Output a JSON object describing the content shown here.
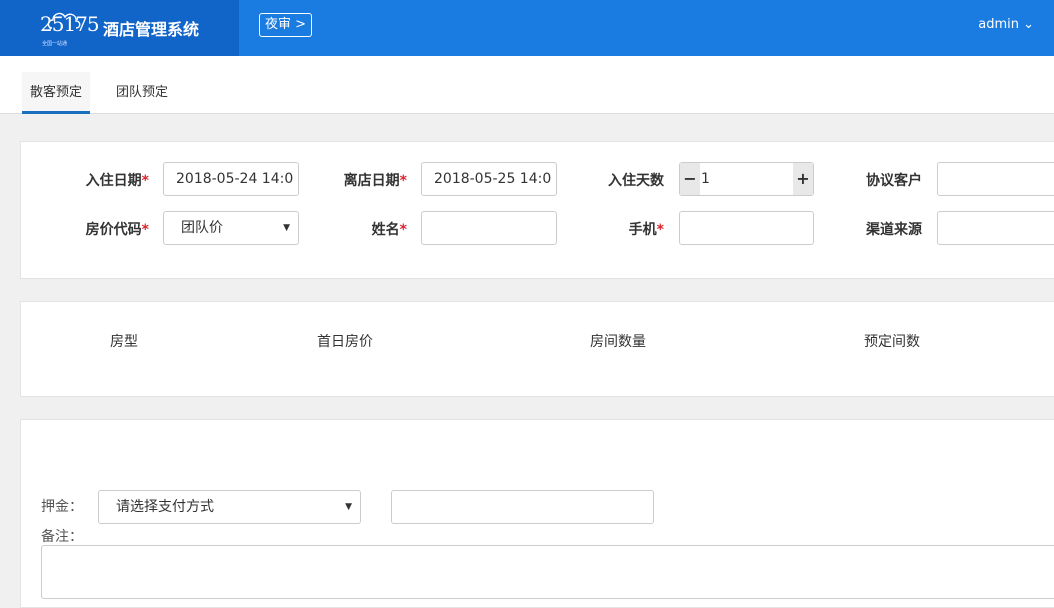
{
  "header": {
    "logo_number": "25175",
    "logo_tagline": "全国一站通",
    "app_name": "酒店管理系统",
    "night_audit_label": "夜审 >",
    "user_label": "admin ⌄"
  },
  "tabs": [
    {
      "label": "散客预定",
      "active": true
    },
    {
      "label": "团队预定",
      "active": false
    }
  ],
  "form": {
    "checkin_date_label": "入住日期",
    "checkin_date_value": "2018-05-24 14:0",
    "checkout_date_label": "离店日期",
    "checkout_date_value": "2018-05-25 14:0",
    "stay_days_label": "入住天数",
    "stay_days_value": "1",
    "agreement_customer_label": "协议客户",
    "rate_code_label": "房价代码",
    "rate_code_value": "团队价",
    "name_label": "姓名",
    "phone_label": "手机",
    "channel_label": "渠道来源",
    "required_mark": "*"
  },
  "room_table": {
    "columns": [
      "房型",
      "首日房价",
      "房间数量",
      "预定间数"
    ]
  },
  "payment": {
    "deposit_label": "押金：",
    "payment_select_value": "请选择支付方式",
    "remark_label": "备注："
  },
  "icons": {
    "minus": "−",
    "plus": "+",
    "dropdown": "▼"
  },
  "colors": {
    "header_bg": "#1a7be0",
    "logo_bg": "#1164c8",
    "required": "#d9262c",
    "tab_active_border": "#1a6fbf"
  }
}
